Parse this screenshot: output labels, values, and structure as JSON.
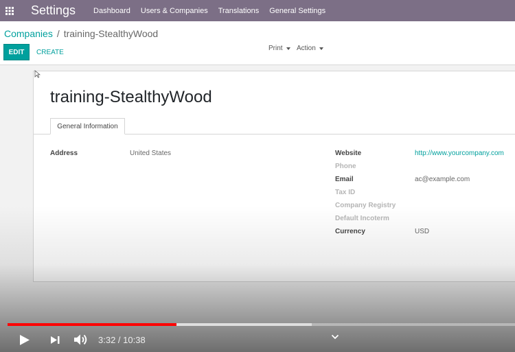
{
  "app": {
    "name": "Settings"
  },
  "menu": [
    {
      "label": "Dashboard"
    },
    {
      "label": "Users & Companies"
    },
    {
      "label": "Translations"
    },
    {
      "label": "General Settings"
    }
  ],
  "breadcrumb": {
    "parent": "Companies",
    "separator": "/",
    "current": "training-StealthyWood"
  },
  "buttons": {
    "edit": "EDIT",
    "create": "CREATE",
    "print": "Print",
    "action": "Action"
  },
  "record": {
    "title": "training-StealthyWood",
    "tab": "General Information",
    "address_label": "Address",
    "address_value": "United States",
    "fields": [
      {
        "label": "Website",
        "value": "http://www.yourcompany.com",
        "empty": false
      },
      {
        "label": "Phone",
        "value": "",
        "empty": true
      },
      {
        "label": "Email",
        "value": "ac@example.com",
        "empty": false
      },
      {
        "label": "Tax ID",
        "value": "",
        "empty": true
      },
      {
        "label": "Company Registry",
        "value": "",
        "empty": true
      },
      {
        "label": "Default Incoterm",
        "value": "",
        "empty": true
      },
      {
        "label": "Currency",
        "value": "USD",
        "empty": false
      }
    ]
  },
  "video": {
    "time": "3:32 / 10:38",
    "played_fraction": 0.3323,
    "buffered_fraction": 0.6
  },
  "colors": {
    "navbar": "#7c6f86",
    "accent": "#00a09d",
    "progress": "#ff0000"
  }
}
